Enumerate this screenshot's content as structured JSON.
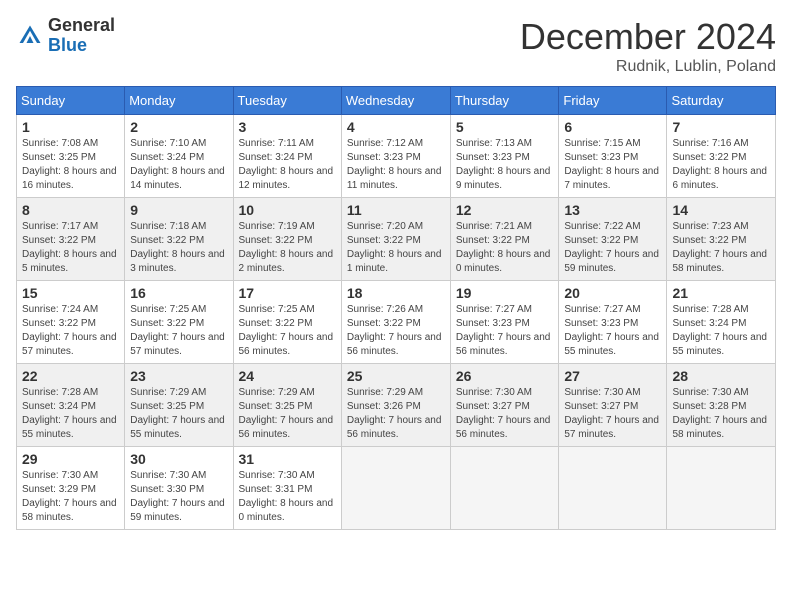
{
  "logo": {
    "general": "General",
    "blue": "Blue"
  },
  "title": {
    "month": "December 2024",
    "location": "Rudnik, Lublin, Poland"
  },
  "weekdays": [
    "Sunday",
    "Monday",
    "Tuesday",
    "Wednesday",
    "Thursday",
    "Friday",
    "Saturday"
  ],
  "weeks": [
    [
      {
        "day": 1,
        "sunrise": "7:08 AM",
        "sunset": "3:25 PM",
        "daylight": "8 hours and 16 minutes"
      },
      {
        "day": 2,
        "sunrise": "7:10 AM",
        "sunset": "3:24 PM",
        "daylight": "8 hours and 14 minutes"
      },
      {
        "day": 3,
        "sunrise": "7:11 AM",
        "sunset": "3:24 PM",
        "daylight": "8 hours and 12 minutes"
      },
      {
        "day": 4,
        "sunrise": "7:12 AM",
        "sunset": "3:23 PM",
        "daylight": "8 hours and 11 minutes"
      },
      {
        "day": 5,
        "sunrise": "7:13 AM",
        "sunset": "3:23 PM",
        "daylight": "8 hours and 9 minutes"
      },
      {
        "day": 6,
        "sunrise": "7:15 AM",
        "sunset": "3:23 PM",
        "daylight": "8 hours and 7 minutes"
      },
      {
        "day": 7,
        "sunrise": "7:16 AM",
        "sunset": "3:22 PM",
        "daylight": "8 hours and 6 minutes"
      }
    ],
    [
      {
        "day": 8,
        "sunrise": "7:17 AM",
        "sunset": "3:22 PM",
        "daylight": "8 hours and 5 minutes"
      },
      {
        "day": 9,
        "sunrise": "7:18 AM",
        "sunset": "3:22 PM",
        "daylight": "8 hours and 3 minutes"
      },
      {
        "day": 10,
        "sunrise": "7:19 AM",
        "sunset": "3:22 PM",
        "daylight": "8 hours and 2 minutes"
      },
      {
        "day": 11,
        "sunrise": "7:20 AM",
        "sunset": "3:22 PM",
        "daylight": "8 hours and 1 minute"
      },
      {
        "day": 12,
        "sunrise": "7:21 AM",
        "sunset": "3:22 PM",
        "daylight": "8 hours and 0 minutes"
      },
      {
        "day": 13,
        "sunrise": "7:22 AM",
        "sunset": "3:22 PM",
        "daylight": "7 hours and 59 minutes"
      },
      {
        "day": 14,
        "sunrise": "7:23 AM",
        "sunset": "3:22 PM",
        "daylight": "7 hours and 58 minutes"
      }
    ],
    [
      {
        "day": 15,
        "sunrise": "7:24 AM",
        "sunset": "3:22 PM",
        "daylight": "7 hours and 57 minutes"
      },
      {
        "day": 16,
        "sunrise": "7:25 AM",
        "sunset": "3:22 PM",
        "daylight": "7 hours and 57 minutes"
      },
      {
        "day": 17,
        "sunrise": "7:25 AM",
        "sunset": "3:22 PM",
        "daylight": "7 hours and 56 minutes"
      },
      {
        "day": 18,
        "sunrise": "7:26 AM",
        "sunset": "3:22 PM",
        "daylight": "7 hours and 56 minutes"
      },
      {
        "day": 19,
        "sunrise": "7:27 AM",
        "sunset": "3:23 PM",
        "daylight": "7 hours and 56 minutes"
      },
      {
        "day": 20,
        "sunrise": "7:27 AM",
        "sunset": "3:23 PM",
        "daylight": "7 hours and 55 minutes"
      },
      {
        "day": 21,
        "sunrise": "7:28 AM",
        "sunset": "3:24 PM",
        "daylight": "7 hours and 55 minutes"
      }
    ],
    [
      {
        "day": 22,
        "sunrise": "7:28 AM",
        "sunset": "3:24 PM",
        "daylight": "7 hours and 55 minutes"
      },
      {
        "day": 23,
        "sunrise": "7:29 AM",
        "sunset": "3:25 PM",
        "daylight": "7 hours and 55 minutes"
      },
      {
        "day": 24,
        "sunrise": "7:29 AM",
        "sunset": "3:25 PM",
        "daylight": "7 hours and 56 minutes"
      },
      {
        "day": 25,
        "sunrise": "7:29 AM",
        "sunset": "3:26 PM",
        "daylight": "7 hours and 56 minutes"
      },
      {
        "day": 26,
        "sunrise": "7:30 AM",
        "sunset": "3:27 PM",
        "daylight": "7 hours and 56 minutes"
      },
      {
        "day": 27,
        "sunrise": "7:30 AM",
        "sunset": "3:27 PM",
        "daylight": "7 hours and 57 minutes"
      },
      {
        "day": 28,
        "sunrise": "7:30 AM",
        "sunset": "3:28 PM",
        "daylight": "7 hours and 58 minutes"
      }
    ],
    [
      {
        "day": 29,
        "sunrise": "7:30 AM",
        "sunset": "3:29 PM",
        "daylight": "7 hours and 58 minutes"
      },
      {
        "day": 30,
        "sunrise": "7:30 AM",
        "sunset": "3:30 PM",
        "daylight": "7 hours and 59 minutes"
      },
      {
        "day": 31,
        "sunrise": "7:30 AM",
        "sunset": "3:31 PM",
        "daylight": "8 hours and 0 minutes"
      },
      null,
      null,
      null,
      null
    ]
  ],
  "labels": {
    "sunrise": "Sunrise:",
    "sunset": "Sunset:",
    "daylight": "Daylight:"
  }
}
